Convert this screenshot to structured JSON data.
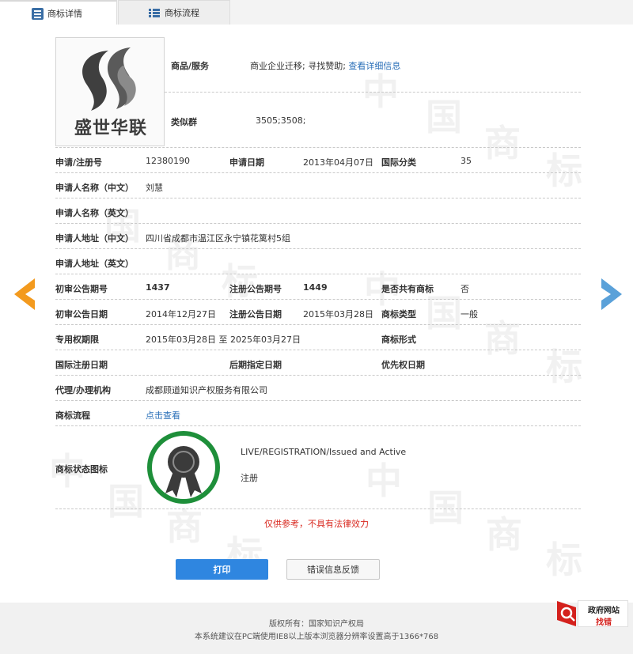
{
  "tabs": [
    {
      "label": "商标详情",
      "active": true
    },
    {
      "label": "商标流程",
      "active": false
    }
  ],
  "logo": {
    "text": "盛世华联"
  },
  "goods": {
    "label": "商品/服务",
    "value": "商业企业迁移; 寻找赞助;",
    "link": "查看详细信息"
  },
  "similar": {
    "label": "类似群",
    "value": "3505;3508;"
  },
  "fields": {
    "reg_no": {
      "label": "申请/注册号",
      "value": "12380190"
    },
    "apply_date": {
      "label": "申请日期",
      "value": "2013年04月07日"
    },
    "intl_class": {
      "label": "国际分类",
      "value": "35"
    },
    "applicant_cn": {
      "label": "申请人名称（中文）",
      "value": "刘慧"
    },
    "applicant_en": {
      "label": "申请人名称（英文）",
      "value": ""
    },
    "address_cn": {
      "label": "申请人地址（中文）",
      "value": "四川省成都市温江区永宁镇花篱村5组"
    },
    "address_en": {
      "label": "申请人地址（英文）",
      "value": ""
    },
    "prelim_issue": {
      "label": "初审公告期号",
      "value": "1437"
    },
    "reg_issue": {
      "label": "注册公告期号",
      "value": "1449"
    },
    "shared": {
      "label": "是否共有商标",
      "value": "否"
    },
    "prelim_date": {
      "label": "初审公告日期",
      "value": "2014年12月27日"
    },
    "reg_date": {
      "label": "注册公告日期",
      "value": "2015年03月28日"
    },
    "tm_type": {
      "label": "商标类型",
      "value": "一般"
    },
    "exclusive_period": {
      "label": "专用权期限",
      "value": "2015年03月28日 至 2025年03月27日"
    },
    "tm_form": {
      "label": "商标形式",
      "value": ""
    },
    "intl_reg_date": {
      "label": "国际注册日期",
      "value": ""
    },
    "later_date": {
      "label": "后期指定日期",
      "value": ""
    },
    "priority_date": {
      "label": "优先权日期",
      "value": ""
    },
    "agent": {
      "label": "代理/办理机构",
      "value": "成都顾道知识产权服务有限公司"
    },
    "process": {
      "label": "商标流程",
      "link": "点击查看"
    },
    "status_icon": {
      "label": "商标状态图标",
      "status_en": "LIVE/REGISTRATION/Issued and Active",
      "status_cn": "注册"
    }
  },
  "disclaimer": "仅供参考，不具有法律效力",
  "buttons": {
    "print": "打印",
    "feedback": "错误信息反馈"
  },
  "footer": {
    "copyright": "版权所有：国家知识产权局",
    "note": "本系统建议在PC端使用IE8以上版本浏览器分辨率设置高于1366*768"
  },
  "corner": {
    "line1": "政府网站",
    "line2": "找错"
  },
  "watermark_chars": [
    "中",
    "国",
    "商",
    "标"
  ],
  "icons": {
    "tab_detail": "document-list-icon",
    "tab_process": "list-icon",
    "prev": "arrow-left-icon",
    "next": "arrow-right-icon",
    "status": "registered-ribbon-badge-icon",
    "corner": "magnifier-icon"
  },
  "colors": {
    "link": "#2a6fb8",
    "print_button": "#2f86e0",
    "disclaimer": "#d9281f",
    "prev_arrow": "#f39a1e",
    "next_arrow": "#5aa1d9",
    "badge_ring": "#1e8f3a"
  }
}
